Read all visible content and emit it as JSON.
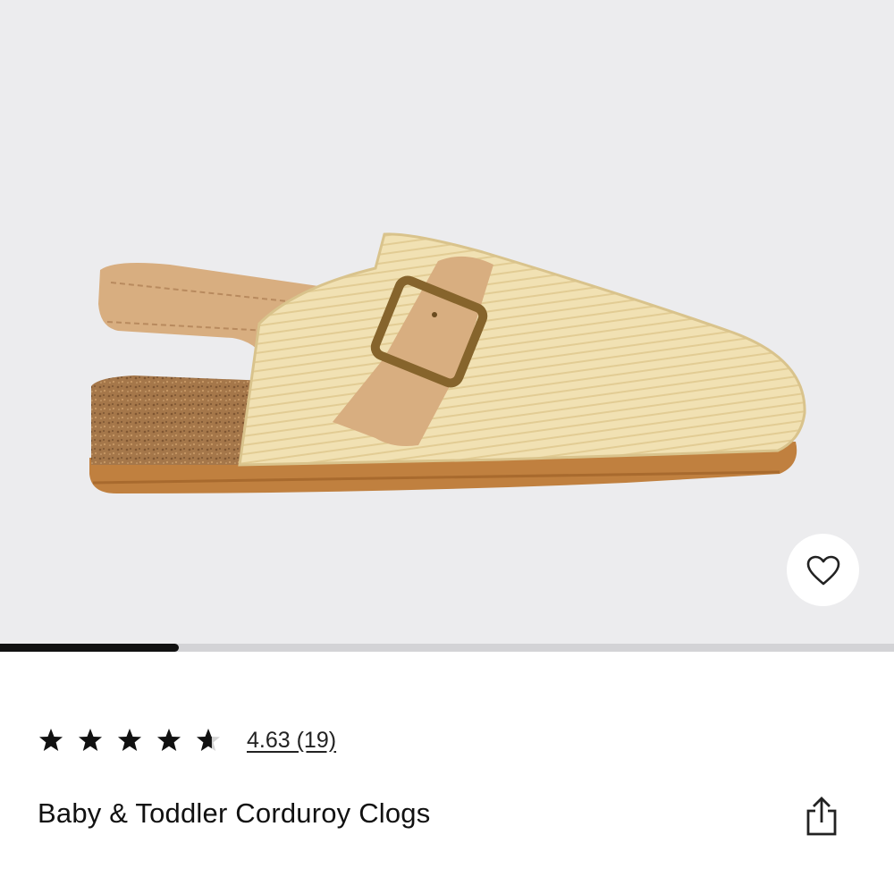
{
  "product": {
    "image_alt": "Baby & Toddler Corduroy Clogs",
    "title": "Baby & Toddler Corduroy Clogs"
  },
  "icons": {
    "favorite": "heart-outline-icon",
    "share": "share-icon",
    "star": "star-icon"
  },
  "carousel": {
    "progress": 0.2
  },
  "rating": {
    "value": 4.63,
    "max": 5,
    "text": "4.63 (19)"
  },
  "colors": {
    "hero_bg": "#ececee",
    "track": "#d3d3d6",
    "thumb": "#111111",
    "corduroy": "#f1e1b3",
    "suede": "#d8ae80",
    "sole": "#c0803f",
    "cork": "#a5774a",
    "buckle": "#86642c"
  }
}
